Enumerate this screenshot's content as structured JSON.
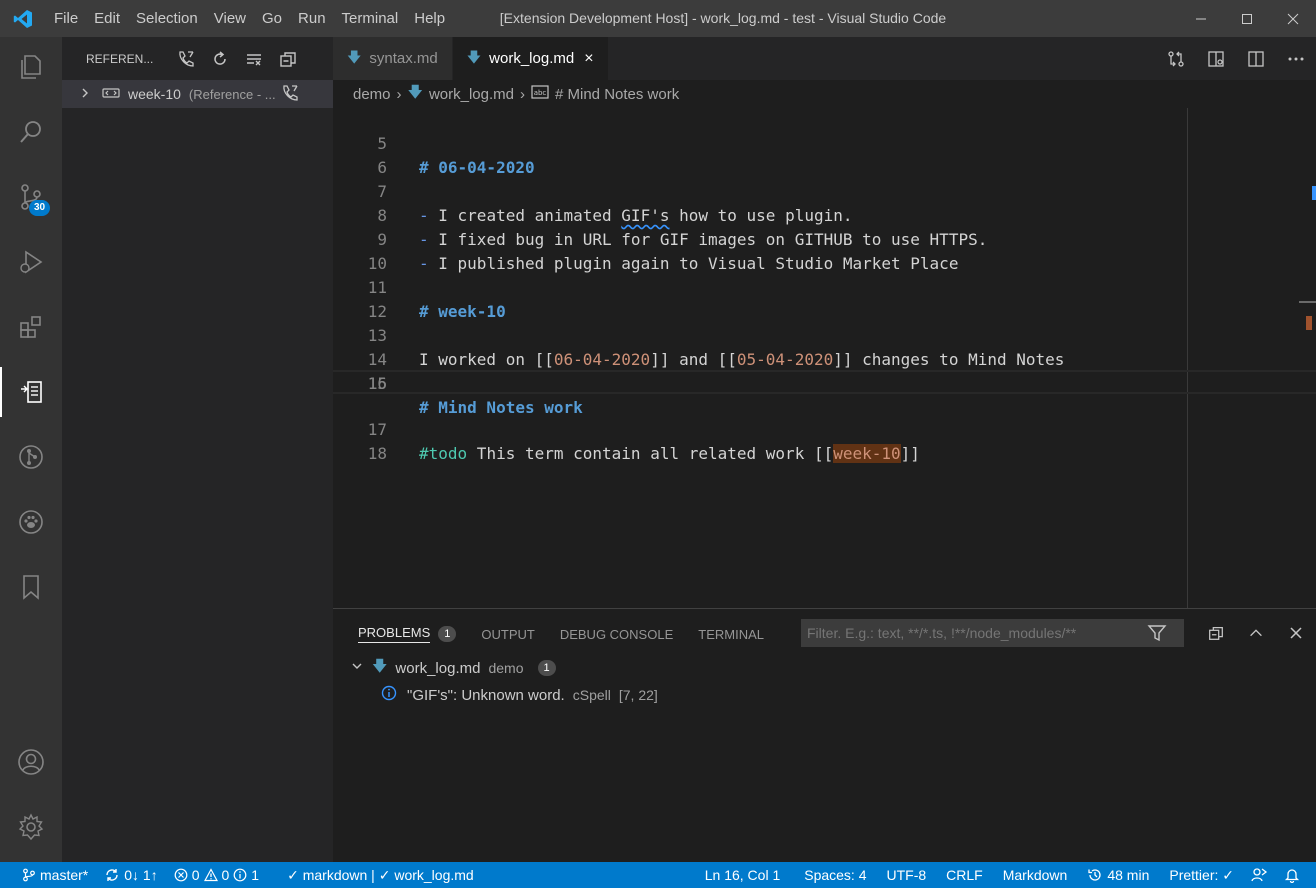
{
  "window": {
    "title": "[Extension Development Host] - work_log.md - test - Visual Studio Code",
    "menu": [
      "File",
      "Edit",
      "Selection",
      "View",
      "Go",
      "Run",
      "Terminal",
      "Help"
    ]
  },
  "activitybar": {
    "items": [
      "explorer-icon",
      "search-icon",
      "source-control-icon",
      "run-debug-icon",
      "extensions-icon",
      "references-icon",
      "git-graph-icon",
      "paw-icon",
      "bookmarks-icon",
      "account-icon",
      "settings-gear-icon"
    ],
    "source_control_badge": "30"
  },
  "sidebar": {
    "header_label": "REFEREN...",
    "tree_item": {
      "label": "week-10",
      "description": "(Reference - ..."
    }
  },
  "tabs": [
    {
      "label": "syntax.md",
      "active": false
    },
    {
      "label": "work_log.md",
      "active": true,
      "close": "×"
    }
  ],
  "breadcrumb": {
    "folder": "demo",
    "file": "work_log.md",
    "symbol": "# Mind Notes work"
  },
  "editor": {
    "lines": [
      {
        "num": "5"
      },
      {
        "num": "6"
      },
      {
        "num": "7"
      },
      {
        "num": "8"
      },
      {
        "num": "9"
      },
      {
        "num": "10"
      },
      {
        "num": "11"
      },
      {
        "num": "12"
      },
      {
        "num": "13"
      },
      {
        "num": "14"
      },
      {
        "num": "15"
      },
      {
        "num": "16"
      },
      {
        "num": "17"
      },
      {
        "num": "18"
      }
    ],
    "l5": "# 06-04-2020",
    "l7_dash": "-",
    "l7_a": " I created animated ",
    "l7_gif": "GIF's",
    "l7_b": " how to use plugin.",
    "l8_dash": "-",
    "l8": " I fixed bug in URL for GIF images on GITHUB to use HTTPS.",
    "l9_dash": "-",
    "l9": " I published plugin again to Visual Studio Market Place",
    "l11": "# week-10",
    "l13_a": "I worked on [[",
    "l13_link1": "06-04-2020",
    "l13_b": "]] and [[",
    "l13_link2": "05-04-2020",
    "l13_c": "]] changes to Mind Notes",
    "l15": "# Mind Notes work",
    "l17_tag": "#todo",
    "l17_a": " This term contain all related work [[",
    "l17_link": "week-10",
    "l17_b": "]]"
  },
  "panel": {
    "tabs": [
      "PROBLEMS",
      "OUTPUT",
      "DEBUG CONSOLE",
      "TERMINAL"
    ],
    "problems_count": "1",
    "filter_placeholder": "Filter. E.g.: text, **/*.ts, !**/node_modules/**",
    "file": {
      "name": "work_log.md",
      "folder": "demo",
      "count": "1"
    },
    "problem": {
      "message": "\"GIF's\": Unknown word.",
      "source": "cSpell",
      "position": "[7, 22]"
    }
  },
  "statusbar": {
    "branch": "master*",
    "sync": "0↓ 1↑",
    "errors": "0",
    "warnings": "0",
    "infos": "1",
    "markdown_check": "✓ markdown | ✓ work_log.md",
    "cursor": "Ln 16, Col 1",
    "spaces": "Spaces: 4",
    "encoding": "UTF-8",
    "eol": "CRLF",
    "language": "Markdown",
    "time": "48 min",
    "prettier": "Prettier: ✓"
  },
  "colors": {
    "accent": "#007acc",
    "heading": "#569cd6",
    "wikilink": "#ce9178",
    "tag": "#4ec9b0",
    "md_icon": "#519aba"
  }
}
